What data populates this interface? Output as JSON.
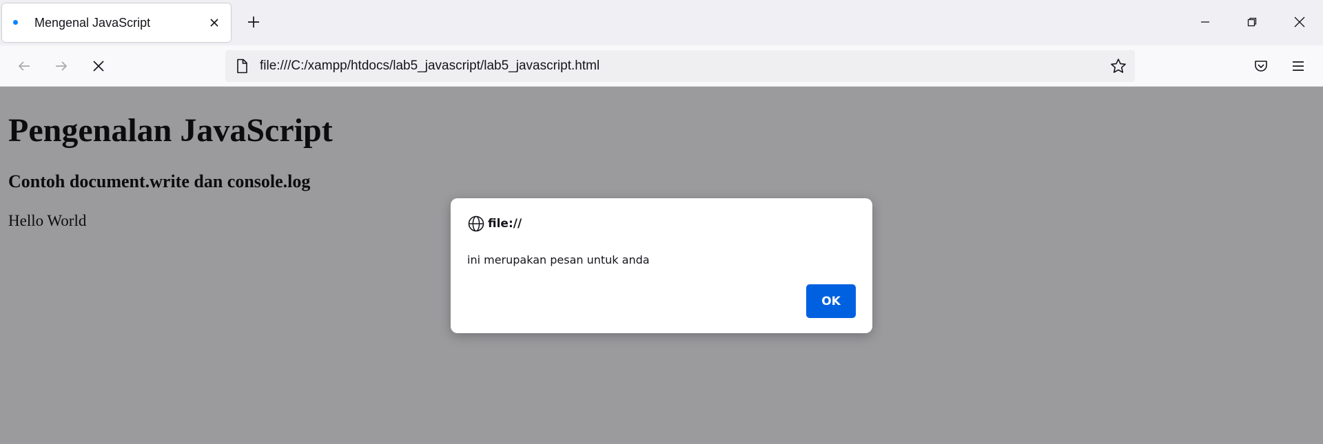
{
  "browser": {
    "tab": {
      "title": "Mengenal JavaScript"
    },
    "url": "file:///C:/xampp/htdocs/lab5_javascript/lab5_javascript.html"
  },
  "page": {
    "heading": "Pengenalan JavaScript",
    "subheading": "Contoh document.write dan console.log",
    "text": "Hello World"
  },
  "dialog": {
    "origin": "file://",
    "message": "ini merupakan pesan untuk anda",
    "ok_label": "OK"
  },
  "colors": {
    "accent": "#0061e0",
    "tab_loading": "#0a84ff",
    "overlay": "#9b9b9e"
  }
}
